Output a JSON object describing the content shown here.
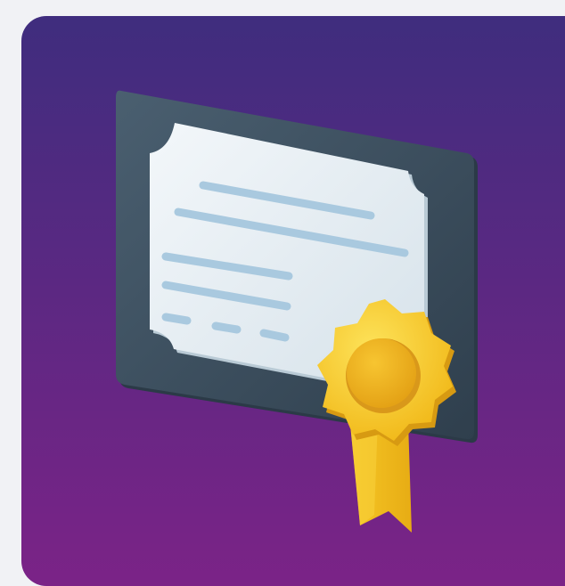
{
  "illustration": {
    "subject": "certificate-with-award-ribbon-icon",
    "colors": {
      "page_background": "#f1f2f5",
      "card_gradient_top": "#3f2d7e",
      "card_gradient_bottom": "#7b2387",
      "certificate_frame": "#3f5262",
      "certificate_paper": "#e6eef3",
      "text_lines": "#a9c9df",
      "seal": "#f5c51d",
      "seal_center": "#ecae1c",
      "ribbon": "#f2be1b"
    }
  }
}
